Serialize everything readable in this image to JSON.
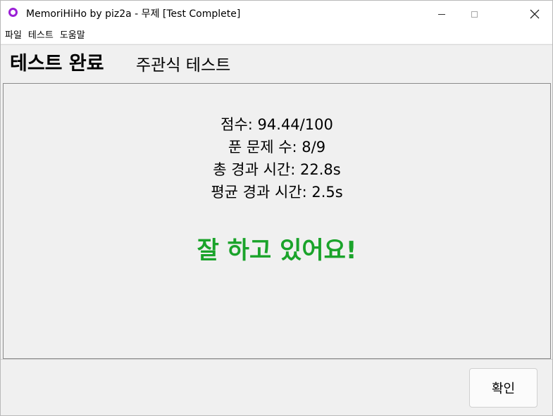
{
  "window": {
    "title": "MemoriHiHo by piz2a - 무제 [Test Complete]",
    "icon": "app-ring-icon",
    "icon_color": "#9b1fd6"
  },
  "menu": [
    "파일",
    "테스트",
    "도움말"
  ],
  "header": {
    "title": "테스트 완료",
    "subtitle": "주관식 테스트"
  },
  "result": {
    "score": "점수: 94.44/100",
    "solved": "푼 문제 수: 8/9",
    "total_time": "총 경과 시간: 22.8s",
    "average_time": "평균 경과 시간: 2.5s",
    "message": "잘 하고 있어요!",
    "message_color": "#1aa32a"
  },
  "footer": {
    "confirm_label": "확인"
  }
}
